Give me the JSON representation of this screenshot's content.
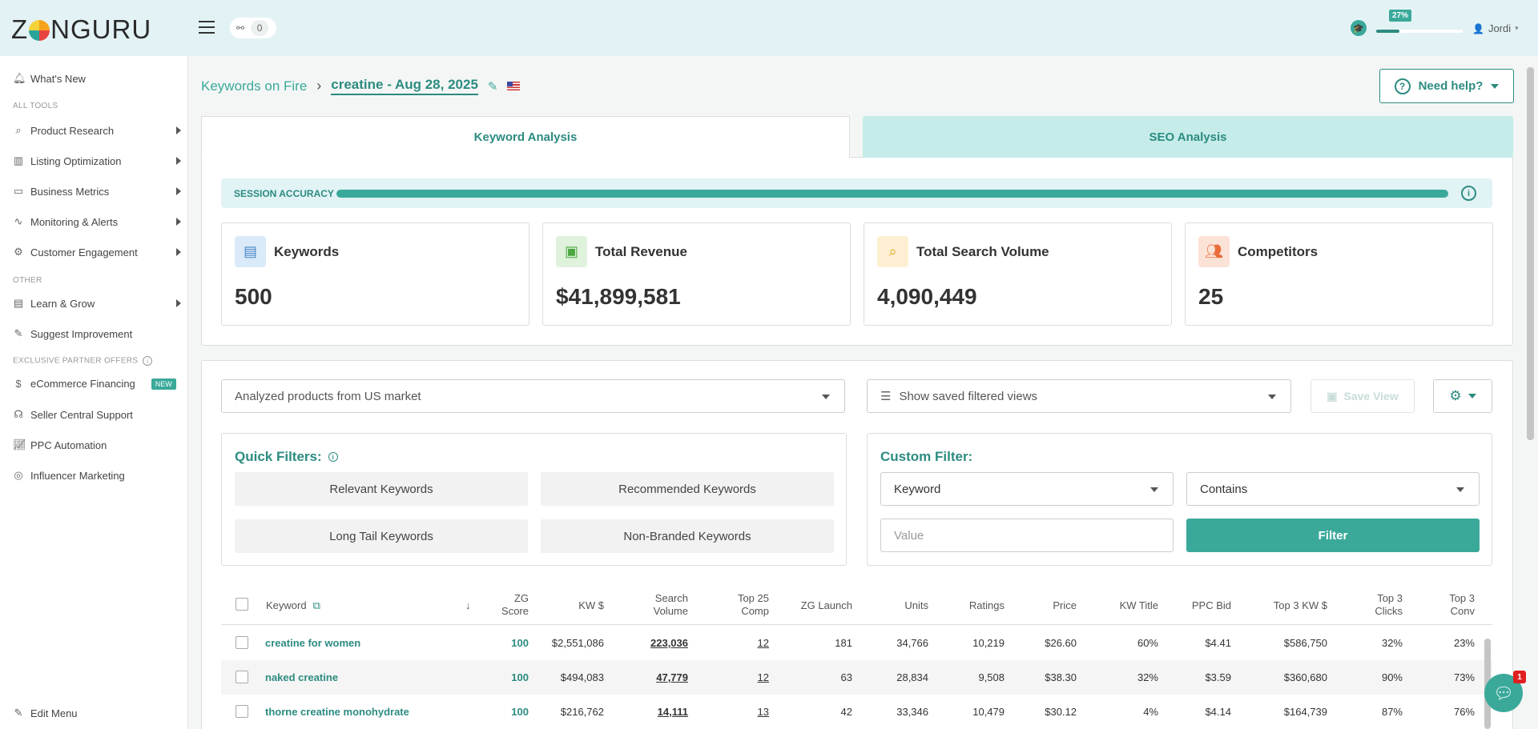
{
  "brand": {
    "logo_before": "Z",
    "logo_after": "NGURU"
  },
  "header": {
    "share_count": "0",
    "progress_label": "27%",
    "progress_fraction": 0.27,
    "user_name": "Jordi"
  },
  "sidebar": {
    "whats_new": "What's New",
    "section_all_tools": "ALL TOOLS",
    "tools": [
      {
        "label": "Product Research"
      },
      {
        "label": "Listing Optimization"
      },
      {
        "label": "Business Metrics"
      },
      {
        "label": "Monitoring & Alerts"
      },
      {
        "label": "Customer Engagement"
      }
    ],
    "section_other": "OTHER",
    "learn_grow": "Learn & Grow",
    "suggest": "Suggest Improvement",
    "section_partner": "EXCLUSIVE PARTNER OFFERS",
    "ecommerce": "eCommerce Financing",
    "new_badge": "NEW",
    "seller_central": "Seller Central Support",
    "ppc": "PPC Automation",
    "influencer": "Influencer Marketing",
    "edit_menu": "Edit Menu"
  },
  "breadcrumb": {
    "parent": "Keywords on Fire",
    "current": "creatine - Aug 28, 2025"
  },
  "help_button": "Need help?",
  "tabs": [
    {
      "label": "Keyword Analysis",
      "active": true
    },
    {
      "label": "SEO Analysis",
      "active": false
    }
  ],
  "session_accuracy": {
    "label": "SESSION ACCURACY",
    "fraction": 1.0
  },
  "stats": [
    {
      "label": "Keywords",
      "value": "500",
      "icon": "folder-icon",
      "color": "#dbeaf8"
    },
    {
      "label": "Total Revenue",
      "value": "$41,899,581",
      "icon": "money-icon",
      "color": "#dff2dc"
    },
    {
      "label": "Total Search Volume",
      "value": "4,090,449",
      "icon": "search-icon",
      "color": "#fdf0d2"
    },
    {
      "label": "Competitors",
      "value": "25",
      "icon": "users-icon",
      "color": "#fbe2d6"
    }
  ],
  "controls": {
    "market_select": "Analyzed products from US market",
    "saved_views_select": "Show saved filtered views",
    "save_view": "Save View"
  },
  "quick_filters": {
    "title": "Quick Filters:",
    "buttons": [
      "Relevant Keywords",
      "Recommended Keywords",
      "Long Tail Keywords",
      "Non-Branded Keywords"
    ]
  },
  "custom_filter": {
    "title": "Custom Filter:",
    "field": "Keyword",
    "operator": "Contains",
    "value_placeholder": "Value",
    "button": "Filter"
  },
  "table": {
    "headers": {
      "keyword": "Keyword",
      "zg_score": [
        "ZG",
        "Score"
      ],
      "kw_dollar": "KW $",
      "search_volume": [
        "Search",
        "Volume"
      ],
      "top25": [
        "Top 25",
        "Comp"
      ],
      "zg_launch": "ZG Launch",
      "units": "Units",
      "ratings": "Ratings",
      "price": "Price",
      "kw_title": "KW Title",
      "ppc_bid": "PPC Bid",
      "top3_kw": "Top 3 KW $",
      "top3_clicks": [
        "Top 3",
        "Clicks"
      ],
      "top3_conv": [
        "Top 3",
        "Conv"
      ]
    },
    "rows": [
      {
        "keyword": "creatine for women",
        "zg_score": "100",
        "kw_dollar": "$2,551,086",
        "search_volume": "223,036",
        "top25": "12",
        "zg_launch": "181",
        "units": "34,766",
        "ratings": "10,219",
        "price": "$26.60",
        "kw_title": "60%",
        "ppc_bid": "$4.41",
        "top3_kw": "$586,750",
        "top3_clicks": "32%",
        "top3_conv": "23%"
      },
      {
        "keyword": "naked creatine",
        "zg_score": "100",
        "kw_dollar": "$494,083",
        "search_volume": "47,779",
        "top25": "12",
        "zg_launch": "63",
        "units": "28,834",
        "ratings": "9,508",
        "price": "$38.30",
        "kw_title": "32%",
        "ppc_bid": "$3.59",
        "top3_kw": "$360,680",
        "top3_clicks": "90%",
        "top3_conv": "73%"
      },
      {
        "keyword": "thorne creatine monohydrate",
        "zg_score": "100",
        "kw_dollar": "$216,762",
        "search_volume": "14,111",
        "top25": "13",
        "zg_launch": "42",
        "units": "33,346",
        "ratings": "10,479",
        "price": "$30.12",
        "kw_title": "4%",
        "ppc_bid": "$4.14",
        "top3_kw": "$164,739",
        "top3_clicks": "87%",
        "top3_conv": "76%"
      }
    ]
  },
  "chat_badge": "1",
  "colors": {
    "accent": "#3aa99a",
    "accent_dark": "#2c8b80",
    "topbar": "#e3f3f5",
    "tab_inactive": "#c5ece8"
  }
}
